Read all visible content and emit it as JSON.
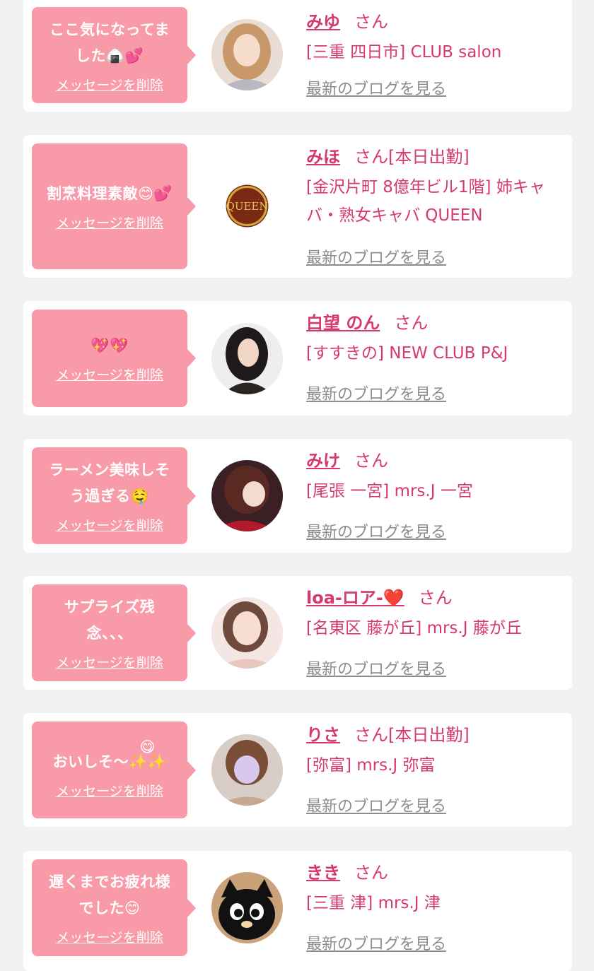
{
  "delete_label": "メッセージを削除",
  "blog_label": "最新のブログを見る",
  "san_label": "さん",
  "colors": {
    "page_bg": "#f1f1f1",
    "bubble": "#f99aa8",
    "accent": "#d63a6c",
    "link_gray": "#8d8d8d"
  },
  "messages": [
    {
      "text": "ここ気になってま\nした",
      "emoji": "🍙💕",
      "name": "みゆ",
      "name_suffix": "",
      "store": "[三重 四日市] CLUB salon",
      "avatar": "girl-photo"
    },
    {
      "text": "割烹料理素敵",
      "emoji": "😊💕",
      "name": "みほ",
      "name_suffix": "[本日出勤]",
      "store": "[金沢片町 8億年ビル1階] 姉キャバ・熟女キャバ QUEEN",
      "avatar": "queen-logo",
      "logo_text": "QUEEN"
    },
    {
      "text": "",
      "emoji": "💖💖",
      "name": "白望 のん",
      "name_suffix": "",
      "store": "[すすきの] NEW CLUB P&J",
      "avatar": "girl-photo"
    },
    {
      "text": "ラーメン美味しそ\nう過ぎる",
      "emoji": "🤤",
      "name": "みけ",
      "name_suffix": "",
      "store": "[尾張 一宮] mrs.J 一宮",
      "avatar": "girl-photo"
    },
    {
      "text": "サプライズ残\n念、、、",
      "emoji": "",
      "name": "loa-ロア-",
      "name_emoji": "❤️",
      "name_suffix": "",
      "store": "[名東区 藤が丘] mrs.J 藤が丘",
      "avatar": "girl-photo"
    },
    {
      "text": "おいしそ〜",
      "emoji": "😋\n✨✨",
      "name": "りさ",
      "name_suffix": "[本日出勤]",
      "store": "[弥富] mrs.J 弥富",
      "avatar": "girl-photo"
    },
    {
      "text": "遅くまでお疲れ様\nでした",
      "emoji": "😊",
      "name": "きき",
      "name_suffix": "",
      "store": "[三重 津] mrs.J 津",
      "avatar": "cat-photo"
    }
  ]
}
